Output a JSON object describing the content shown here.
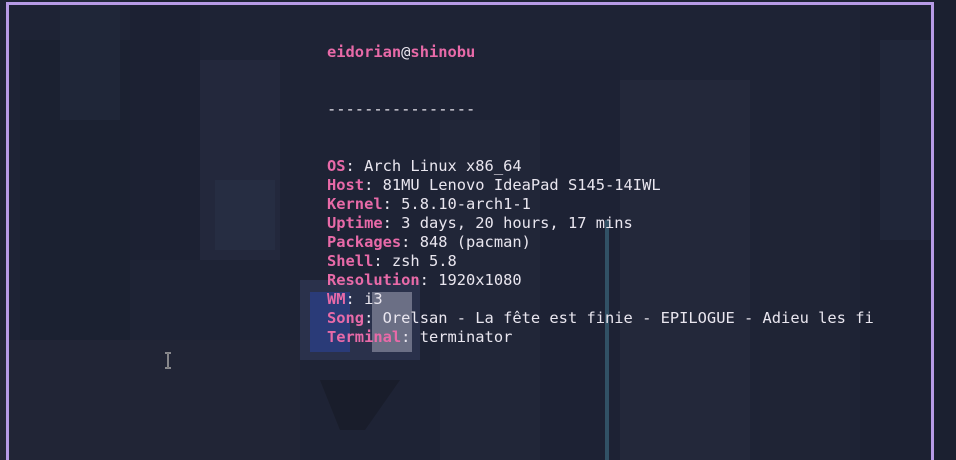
{
  "terminal": {
    "user": "eidorian",
    "at": "@",
    "host": "shinobu",
    "separator": "----------------",
    "rows": [
      {
        "key": "OS",
        "value": "Arch Linux x86_64"
      },
      {
        "key": "Host",
        "value": "81MU Lenovo IdeaPad S145-14IWL"
      },
      {
        "key": "Kernel",
        "value": "5.8.10-arch1-1"
      },
      {
        "key": "Uptime",
        "value": "3 days, 20 hours, 17 mins"
      },
      {
        "key": "Packages",
        "value": "848 (pacman)"
      },
      {
        "key": "Shell",
        "value": "zsh 5.8"
      },
      {
        "key": "Resolution",
        "value": "1920x1080"
      },
      {
        "key": "WM",
        "value": "i3"
      },
      {
        "key": "Song",
        "value": "Orelsan - La fête est finie - EPILOGUE - Adieu les fi"
      },
      {
        "key": "Terminal",
        "value": "terminator"
      }
    ],
    "key_suffix": ": "
  },
  "colors": {
    "accent": "#e86aa8",
    "text": "#e9e6ef",
    "border": "#b79be6"
  },
  "icons": {
    "mouse_cursor": "text-cursor-icon"
  }
}
